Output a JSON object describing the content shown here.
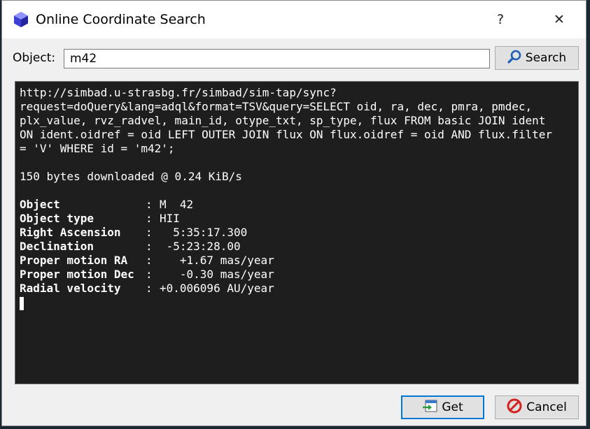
{
  "window": {
    "title": "Online Coordinate Search",
    "help": "?",
    "close": "✕"
  },
  "search": {
    "label": "Object:",
    "value": "m42",
    "button_label": "Search"
  },
  "console": {
    "query_lines": [
      "http://simbad.u-strasbg.fr/simbad/sim-tap/sync?",
      "request=doQuery&lang=adql&format=TSV&query=SELECT oid, ra, dec, pmra, pmdec,",
      "plx_value, rvz_radvel, main_id, otype_txt, sp_type, flux FROM basic JOIN ident",
      "ON ident.oidref = oid LEFT OUTER JOIN flux ON flux.oidref = oid AND flux.filter",
      "= 'V' WHERE id = 'm42';"
    ],
    "download_status": "150 bytes downloaded @ 0.24 KiB/s",
    "results": [
      {
        "key": "Object",
        "value": "M  42"
      },
      {
        "key": "Object type",
        "value": "HII"
      },
      {
        "key": "Right Ascension",
        "value": "  5:35:17.300"
      },
      {
        "key": "Declination",
        "value": " -5:23:28.00"
      },
      {
        "key": "Proper motion RA",
        "value": "   +1.67 mas/year"
      },
      {
        "key": "Proper motion Dec",
        "value": "   -0.30 mas/year"
      },
      {
        "key": "Radial velocity",
        "value": "+0.006096 AU/year"
      }
    ],
    "separator": ":"
  },
  "footer": {
    "get_label": "Get",
    "cancel_label": "Cancel"
  },
  "colors": {
    "accent": "#0078d7",
    "console_bg": "#1e1e1e",
    "cancel_red": "#d42020"
  }
}
